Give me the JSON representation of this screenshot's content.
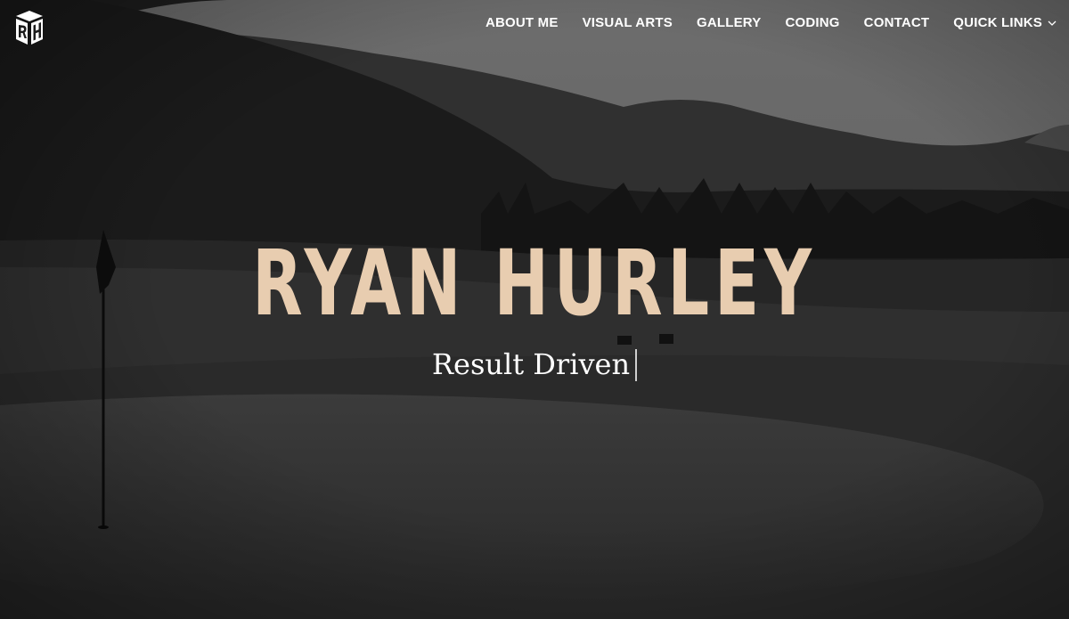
{
  "site": {
    "logo_icon": "rh-monogram-logo",
    "nav": {
      "items": [
        {
          "label": "ABOUT ME"
        },
        {
          "label": "VISUAL ARTS"
        },
        {
          "label": "GALLERY"
        },
        {
          "label": "CODING"
        },
        {
          "label": "CONTACT"
        },
        {
          "label": "QUICK LINKS",
          "icon": "chevron-down-icon"
        }
      ]
    }
  },
  "hero": {
    "title": "RYAN HURLEY",
    "subtitle": "Result Driven",
    "colors": {
      "title": "#e8cdb0",
      "subtitle": "#ffffff",
      "overlay": "#000000"
    }
  }
}
